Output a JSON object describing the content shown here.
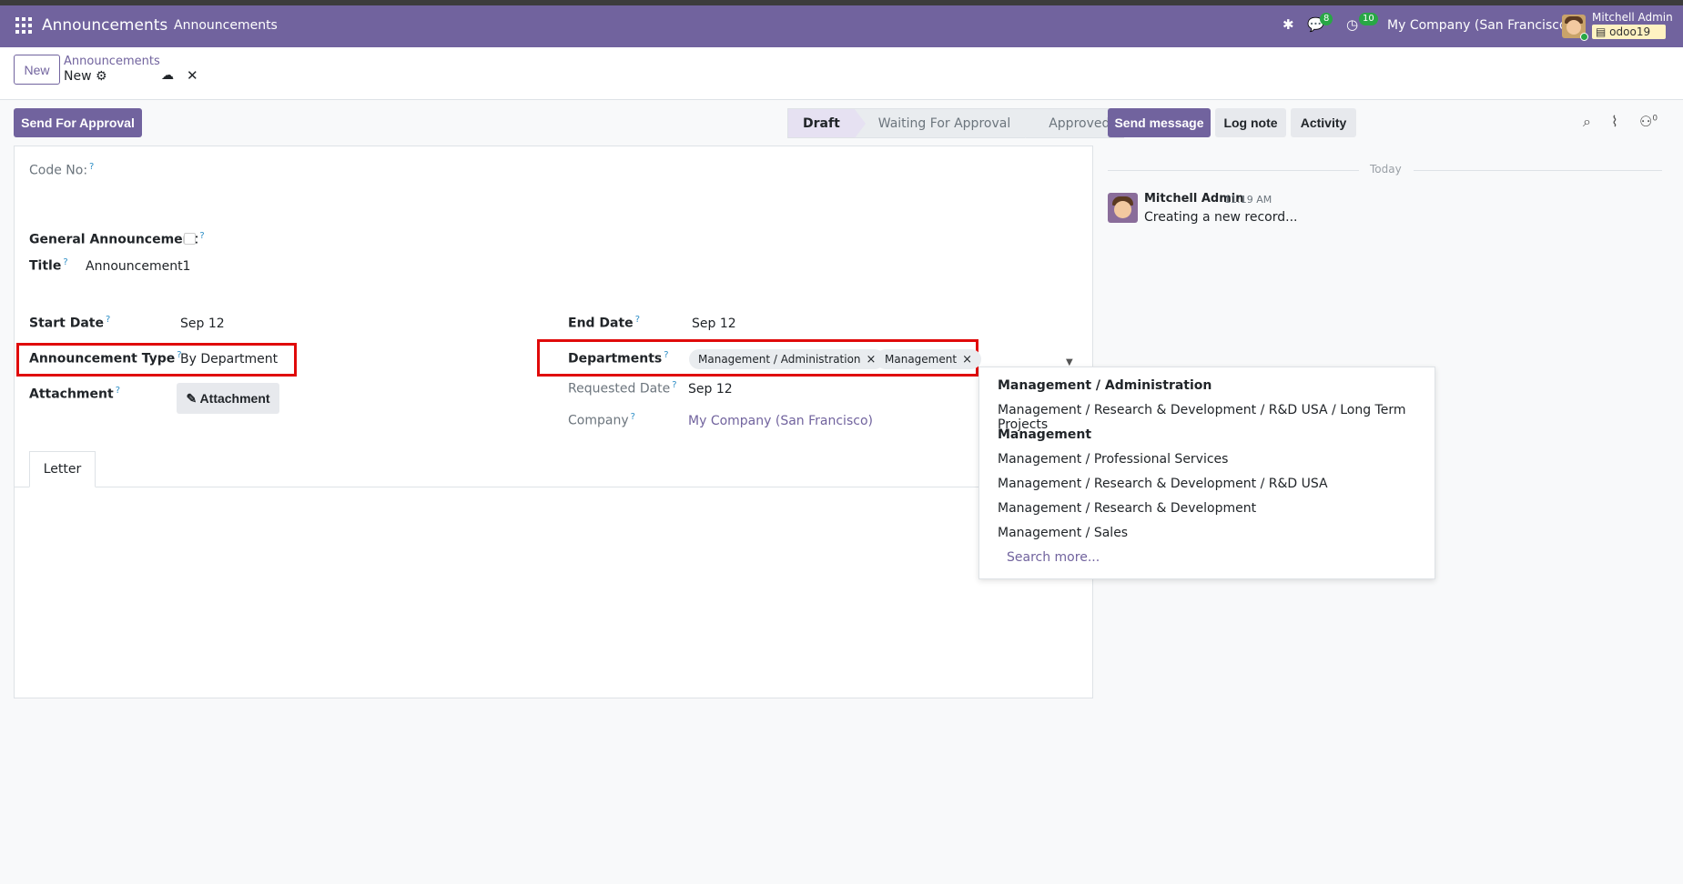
{
  "navbar": {
    "app_name": "Announcements",
    "menu_item": "Announcements",
    "messages_count": "8",
    "activities_count": "10",
    "company": "My Company (San Francisco)",
    "user_name": "Mitchell Admin",
    "database": "odoo19",
    "accent": "#71639e"
  },
  "control_panel": {
    "new_label": "New",
    "breadcrumb_parent": "Announcements",
    "breadcrumb_current": "New"
  },
  "actions": {
    "send_for_approval": "Send For Approval"
  },
  "statusbar": {
    "stages": [
      "Draft",
      "Waiting For Approval",
      "Approved"
    ],
    "active": "Draft"
  },
  "form": {
    "code_no_label": "Code No:",
    "general_announcement_label": "General Announcement",
    "title_label": "Title",
    "title_value": "Announcement1",
    "start_date_label": "Start Date",
    "start_date_value": "Sep 12",
    "end_date_label": "End Date",
    "end_date_value": "Sep 12",
    "announcement_type_label": "Announcement Type",
    "announcement_type_value": "By Department",
    "departments_label": "Departments",
    "department_tags": [
      "Management / Administration",
      "Management"
    ],
    "attachment_label": "Attachment",
    "attachment_button": "Attachment",
    "requested_date_label": "Requested Date",
    "requested_date_value": "Sep 12",
    "company_label": "Company",
    "company_value": "My Company (San Francisco)",
    "help_marker": "?",
    "tab_letter": "Letter",
    "tag_remove": "×"
  },
  "dropdown": {
    "items": [
      {
        "label": "Management / Administration",
        "bold": true
      },
      {
        "label": "Management / Research & Development / R&D USA / Long Term Projects",
        "bold": false
      },
      {
        "label": "Management",
        "bold": true
      },
      {
        "label": "Management / Professional Services",
        "bold": false
      },
      {
        "label": "Management / Research & Development / R&D USA",
        "bold": false
      },
      {
        "label": "Management / Research & Development",
        "bold": false
      },
      {
        "label": "Management / Sales",
        "bold": false
      }
    ],
    "search_more": "Search more..."
  },
  "chatter": {
    "send_message": "Send message",
    "log_note": "Log note",
    "activity": "Activity",
    "followers_count": "0",
    "date_separator": "Today",
    "message": {
      "author": "Mitchell Admin",
      "time": "11:19 AM",
      "body": "Creating a new record..."
    }
  }
}
